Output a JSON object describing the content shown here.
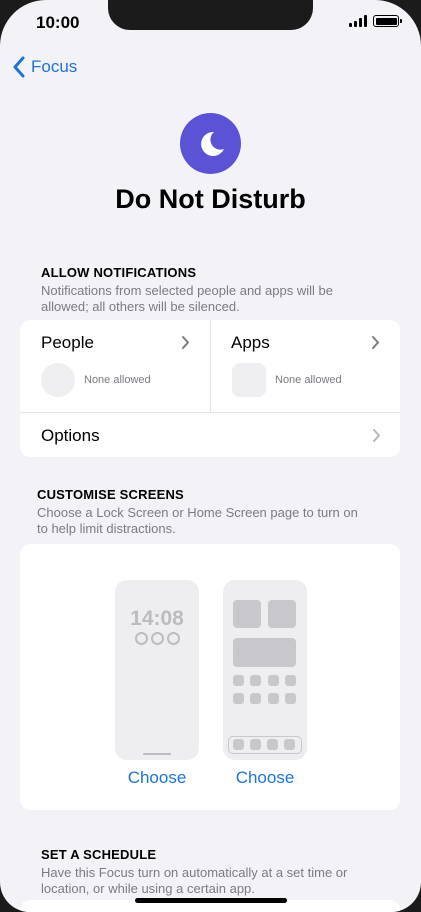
{
  "status": {
    "time": "10:00"
  },
  "nav": {
    "back_label": "Focus"
  },
  "header": {
    "title": "Do Not Disturb"
  },
  "allow_notifications": {
    "heading": "ALLOW NOTIFICATIONS",
    "description_line1": "Notifications from selected people and apps will be",
    "description_line2": "allowed; all others will be silenced.",
    "people": {
      "label": "People",
      "status": "None allowed"
    },
    "apps": {
      "label": "Apps",
      "status": "None allowed"
    },
    "options": {
      "label": "Options"
    }
  },
  "customise_screens": {
    "heading": "CUSTOMISE SCREENS",
    "description_line1": "Choose a Lock Screen or Home Screen page to turn on",
    "description_line2": "to help limit distractions.",
    "lock_screen": {
      "time": "14:08",
      "choose_label": "Choose"
    },
    "home_screen": {
      "choose_label": "Choose"
    }
  },
  "schedule": {
    "heading": "SET A SCHEDULE",
    "description_line1": "Have this Focus turn on automatically at a set time or",
    "description_line2": "location, or while using a certain app."
  },
  "colors": {
    "accent": "#1e74d6",
    "focus_icon": "#5b52d6"
  },
  "icons": [
    "chevron-left-icon",
    "moon-icon",
    "chevron-right-icon",
    "signal-icon",
    "battery-icon"
  ]
}
